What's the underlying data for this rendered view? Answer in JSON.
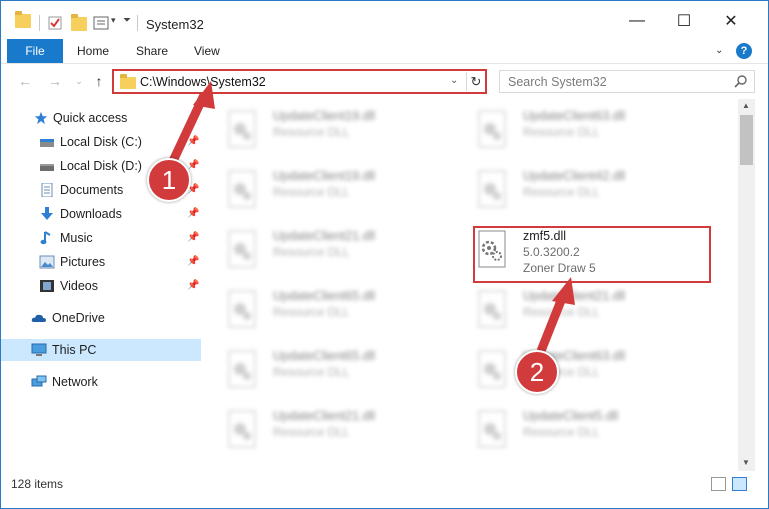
{
  "window": {
    "title": "System32",
    "controls": {
      "minimize": "—",
      "maximize": "☐",
      "close": "✕"
    }
  },
  "ribbon": {
    "tabs": [
      "File",
      "Home",
      "Share",
      "View"
    ]
  },
  "address_bar": {
    "path": "C:\\Windows\\System32",
    "search_placeholder": "Search System32"
  },
  "sidebar": {
    "items": [
      {
        "label": "Quick access",
        "icon": "star-icon",
        "pinned": false
      },
      {
        "label": "Local Disk (C:)",
        "icon": "drive-icon",
        "pinned": true
      },
      {
        "label": "Local Disk (D:)",
        "icon": "drive-icon",
        "pinned": true
      },
      {
        "label": "Documents",
        "icon": "documents-icon",
        "pinned": true
      },
      {
        "label": "Downloads",
        "icon": "download-icon",
        "pinned": true
      },
      {
        "label": "Music",
        "icon": "music-icon",
        "pinned": true
      },
      {
        "label": "Pictures",
        "icon": "pictures-icon",
        "pinned": true
      },
      {
        "label": "Videos",
        "icon": "videos-icon",
        "pinned": true
      },
      {
        "label": "OneDrive",
        "icon": "onedrive-icon",
        "pinned": false
      },
      {
        "label": "This PC",
        "icon": "pc-icon",
        "pinned": false,
        "selected": true
      },
      {
        "label": "Network",
        "icon": "network-icon",
        "pinned": false
      }
    ]
  },
  "files": {
    "left": [
      {
        "name": "UpdateClient19.dll",
        "type": "Resource DLL"
      },
      {
        "name": "UpdateClient19.dll",
        "type": "Resource DLL"
      },
      {
        "name": "UpdateClient21.dll",
        "type": "Resource DLL"
      },
      {
        "name": "UpdateClient65.dll",
        "type": "Resource DLL"
      },
      {
        "name": "UpdateClient65.dll",
        "type": "Resource DLL"
      },
      {
        "name": "UpdateClient21.dll",
        "type": "Resource DLL"
      }
    ],
    "right": [
      {
        "name": "UpdateClient63.dll",
        "type": "Resource DLL"
      },
      {
        "name": "UpdateClient42.dll",
        "type": "Resource DLL"
      },
      {
        "name": "zmf5.dll",
        "version": "5.0.3200.2",
        "type": "Zoner Draw 5",
        "highlighted": true
      },
      {
        "name": "UpdateClient21.dll",
        "type": "Resource DLL"
      },
      {
        "name": "UpdateClient63.dll",
        "type": "Resource DLL"
      },
      {
        "name": "UpdateClient5.dll",
        "type": "Resource DLL"
      }
    ]
  },
  "status": {
    "item_count": "128 items"
  },
  "annotations": {
    "step1": "1",
    "step2": "2",
    "color": "#d23b3b"
  }
}
